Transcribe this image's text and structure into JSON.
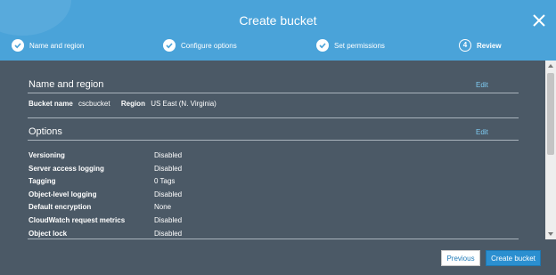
{
  "modal": {
    "title": "Create bucket",
    "close_icon": "close-icon",
    "colors": {
      "header": "#4aa3d9",
      "body": "#4b5966",
      "link": "#7ecbf2",
      "primary_button": "#2b8fd0"
    }
  },
  "steps": [
    {
      "label": "Name and region",
      "status": "complete",
      "icon": "check-circle-icon"
    },
    {
      "label": "Configure options",
      "status": "complete",
      "icon": "check-circle-icon"
    },
    {
      "label": "Set permissions",
      "status": "complete",
      "icon": "check-circle-icon"
    },
    {
      "label": "Review",
      "status": "current",
      "number": "4"
    }
  ],
  "name_region": {
    "title": "Name and region",
    "edit_label": "Edit",
    "bucket_name_label": "Bucket name",
    "bucket_name_value": "cscbucket",
    "region_label": "Region",
    "region_value": "US East (N. Virginia)"
  },
  "options": {
    "title": "Options",
    "edit_label": "Edit",
    "rows": [
      {
        "label": "Versioning",
        "value": "Disabled"
      },
      {
        "label": "Server access logging",
        "value": "Disabled"
      },
      {
        "label": "Tagging",
        "value": "0 Tags"
      },
      {
        "label": "Object-level logging",
        "value": "Disabled"
      },
      {
        "label": "Default encryption",
        "value": "None"
      },
      {
        "label": "CloudWatch request metrics",
        "value": "Disabled"
      },
      {
        "label": "Object lock",
        "value": "Disabled"
      }
    ]
  },
  "footer": {
    "previous_label": "Previous",
    "create_label": "Create bucket"
  }
}
